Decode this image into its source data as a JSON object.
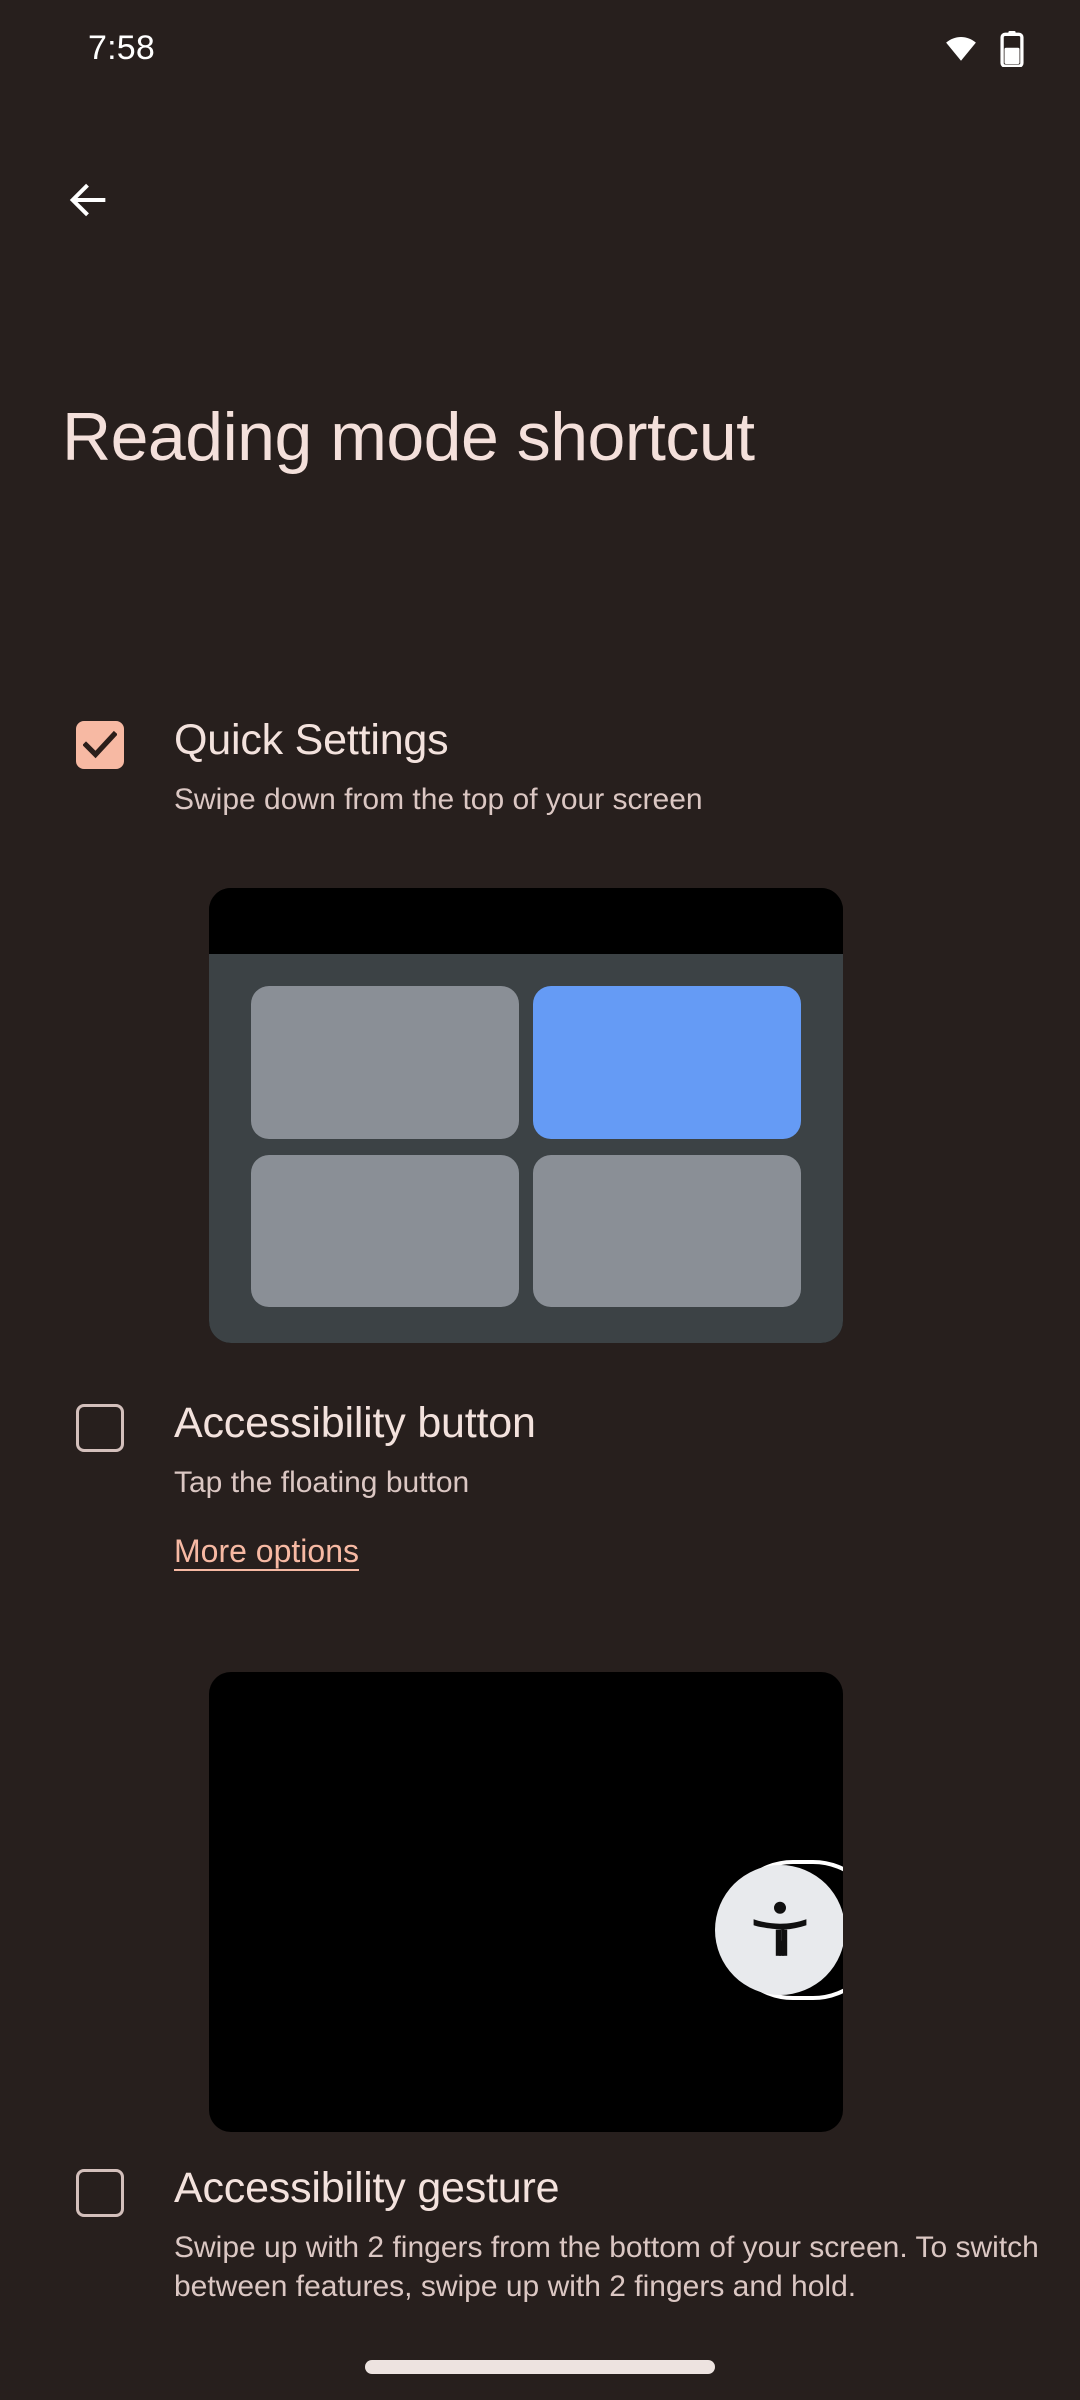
{
  "status_bar": {
    "time": "7:58",
    "icons": [
      "wifi-icon",
      "battery-icon"
    ]
  },
  "nav": {
    "back_icon": "back-arrow-icon"
  },
  "header": {
    "title": "Reading mode shortcut"
  },
  "options": [
    {
      "id": "quick-settings",
      "title": "Quick Settings",
      "subtitle": "Swipe down from the top of your screen",
      "checked": true,
      "illustration": "quick-settings-panel"
    },
    {
      "id": "accessibility-button",
      "title": "Accessibility button",
      "subtitle": "Tap the floating button",
      "link_label": "More options",
      "checked": false,
      "illustration": "floating-accessibility-button"
    },
    {
      "id": "accessibility-gesture",
      "title": "Accessibility gesture",
      "subtitle": "Swipe up with 2 fingers from the bottom of your screen. To switch between features, swipe up with 2 fingers and hold.",
      "checked": false
    }
  ],
  "colors": {
    "background": "#271F1D",
    "title_text": "#F4E0DB",
    "body_text": "#DBC7C3",
    "accent": "#F7B9A3",
    "tile_active": "#659BF5",
    "tile_inactive": "#8A8F96",
    "panel_body": "#3C4245",
    "panel_bar": "#000000"
  },
  "system": {
    "gesture_nav_pill": "home-indicator"
  }
}
